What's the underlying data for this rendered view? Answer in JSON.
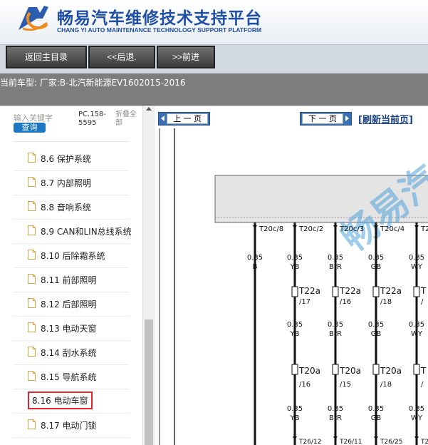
{
  "header": {
    "title": "畅易汽车维修技术支持平台",
    "subtitle": "CHANG YI AUTO MAINTENANCE TECHNOLOGY SUPPORT PLATFORM"
  },
  "nav": {
    "home": "返回主目录",
    "back": "<<后退.",
    "forward": ">>前进"
  },
  "car_info": "当前车型:  厂家:B-北汽新能源EV1602015-2016",
  "sidebar": {
    "search_label": "输入关键字",
    "query_button": "查询",
    "pc_label": "PC.158-5595",
    "collapse_label": "折叠全部",
    "items": [
      {
        "label": "8.6 保护系统"
      },
      {
        "label": "8.7 内部照明"
      },
      {
        "label": "8.8 音响系统"
      },
      {
        "label": "8.9 CAN和LIN总线系统"
      },
      {
        "label": "8.10 后除霜系统"
      },
      {
        "label": "8.11 前部照明"
      },
      {
        "label": "8.12 后部照明"
      },
      {
        "label": "8.13 电动天窗"
      },
      {
        "label": "8.14 刮水系统"
      },
      {
        "label": "8.15 导航系统"
      },
      {
        "label": "8.16 电动车窗",
        "selected": true
      },
      {
        "label": "8.17 电动门锁"
      }
    ]
  },
  "viewer": {
    "prev_page": "上 一 页",
    "next_page": "下 一 页",
    "refresh": "[刷新当前页]",
    "watermark": "畅易汽",
    "wires": [
      {
        "top_pin": "T20c/8",
        "size1": "0.35",
        "color1": "B"
      },
      {
        "top_pin": "T20c/2",
        "size1": "0.35",
        "color1": "YB",
        "conn1": "T22a",
        "conn1_pin": "/17",
        "size2": "0.35",
        "color2": "YB",
        "conn2": "T20a",
        "conn2_pin": "/16",
        "size3": "0.35",
        "color3": "YB",
        "bottom_pin": "T26/12"
      },
      {
        "top_pin": "T20c/3",
        "size1": "0.35",
        "color1": "BrR",
        "conn1": "T22a",
        "conn1_pin": "/16",
        "size2": "0.35",
        "color2": "BrR",
        "conn2": "T20a",
        "conn2_pin": "/15",
        "size3": "0.35",
        "color3": "BrR",
        "bottom_pin": "T26/11"
      },
      {
        "top_pin": "T20c/4",
        "size1": "0.35",
        "color1": "GB",
        "conn1": "T22a",
        "conn1_pin": "/18",
        "size2": "0.35",
        "color2": "GB",
        "conn2": "T20a",
        "conn2_pin": "/18",
        "size3": "0.35",
        "color3": "GB",
        "bottom_pin": "T26/25"
      },
      {
        "top_pin": "T2",
        "size1": "0.35",
        "color1": "WY",
        "conn1": "T",
        "conn1_pin": "/",
        "size2": "0.35",
        "color2": "WY",
        "conn2": "T",
        "conn2_pin": "/",
        "size3": "0.35",
        "color3": "WY",
        "bottom_pin": "T2"
      }
    ]
  },
  "colors": {
    "brand_blue": "#1f4fa6",
    "query_blue": "#1d77c2",
    "selected_red": "#e0262c"
  }
}
